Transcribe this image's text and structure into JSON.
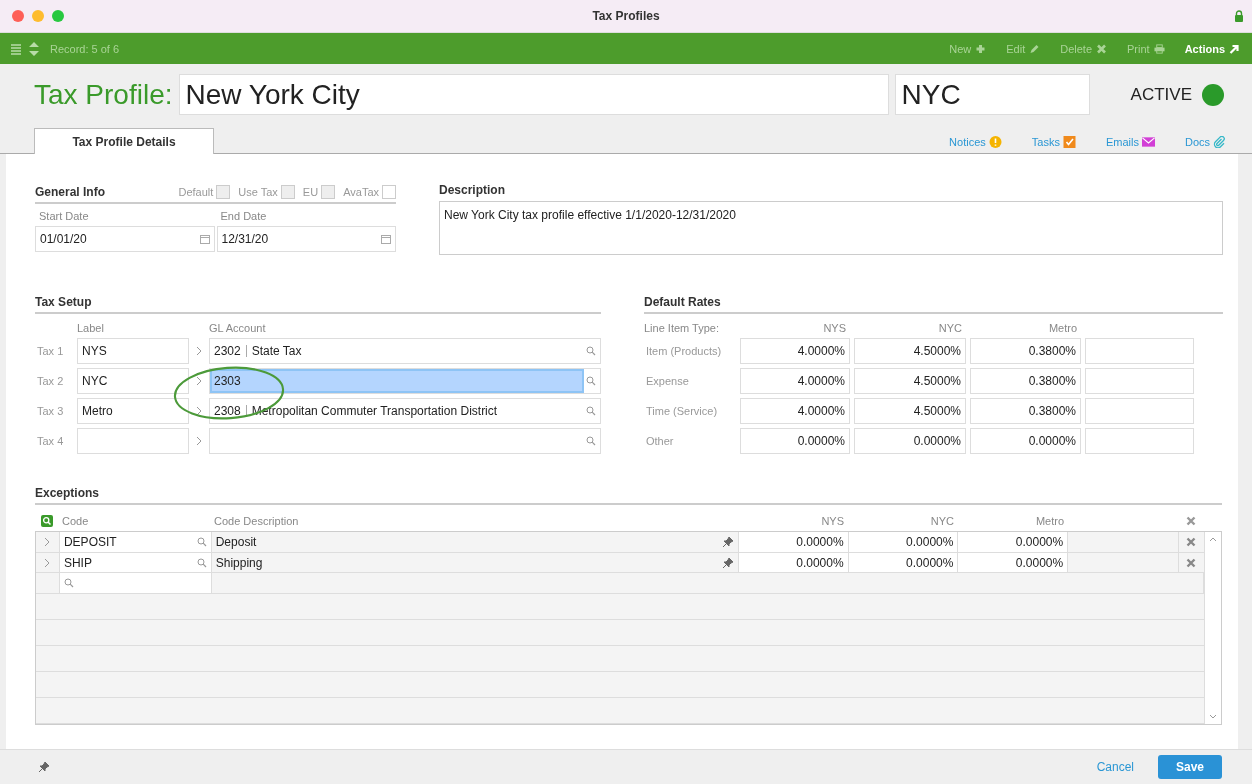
{
  "window": {
    "title": "Tax Profiles"
  },
  "toolbar": {
    "record": "Record: 5 of 6",
    "actions": [
      {
        "label": "New",
        "kind": "new",
        "disabled": true
      },
      {
        "label": "Edit",
        "kind": "edit",
        "disabled": true
      },
      {
        "label": "Delete",
        "kind": "delete",
        "disabled": true
      },
      {
        "label": "Print",
        "kind": "print",
        "disabled": true
      },
      {
        "label": "Actions",
        "kind": "actions",
        "disabled": false
      }
    ]
  },
  "header": {
    "label": "Tax Profile:",
    "name": "New York City",
    "code": "NYC",
    "status": "ACTIVE",
    "active": true
  },
  "tabs": [
    {
      "label": "Tax Profile Details",
      "selected": true
    }
  ],
  "links": [
    {
      "label": "Notices",
      "kind": "notices"
    },
    {
      "label": "Tasks",
      "kind": "tasks"
    },
    {
      "label": "Emails",
      "kind": "emails"
    },
    {
      "label": "Docs",
      "kind": "docs"
    }
  ],
  "general_info": {
    "title": "General Info",
    "flags": [
      {
        "label": "Default",
        "checked": false,
        "disabled": true
      },
      {
        "label": "Use Tax",
        "checked": false,
        "disabled": true
      },
      {
        "label": "EU",
        "checked": false,
        "disabled": true
      },
      {
        "label": "AvaTax",
        "checked": false,
        "disabled": false
      }
    ],
    "start_date": {
      "label": "Start Date",
      "value": "01/01/20"
    },
    "end_date": {
      "label": "End Date",
      "value": "12/31/20"
    }
  },
  "description": {
    "title": "Description",
    "value": "New York City tax profile effective 1/1/2020-12/31/2020"
  },
  "tax_setup": {
    "title": "Tax Setup",
    "label_header": "Label",
    "account_header": "GL Account",
    "rows": [
      {
        "name": "Tax 1",
        "label": "NYS",
        "account": "2302",
        "account_name": "State Tax",
        "selected": false
      },
      {
        "name": "Tax 2",
        "label": "NYC",
        "account": "2303",
        "selected": true
      },
      {
        "name": "Tax 3",
        "label": "Metro",
        "account": "2308",
        "account_name": "Metropolitan Commuter Transportation District",
        "selected": false
      },
      {
        "name": "Tax 4",
        "selected": false
      }
    ]
  },
  "default_rates": {
    "title": "Default Rates",
    "type_header": "Line Item Type:",
    "columns": [
      "NYS",
      "NYC",
      "Metro"
    ],
    "rows": [
      {
        "type": "Item (Products)",
        "rates": [
          "4.0000%",
          "4.5000%",
          "0.3800%"
        ]
      },
      {
        "type": "Expense",
        "rates": [
          "4.0000%",
          "4.5000%",
          "0.3800%"
        ]
      },
      {
        "type": "Time (Service)",
        "rates": [
          "4.0000%",
          "4.5000%",
          "0.3800%"
        ]
      },
      {
        "type": "Other",
        "rates": [
          "0.0000%",
          "0.0000%",
          "0.0000%"
        ]
      }
    ]
  },
  "exceptions": {
    "title": "Exceptions",
    "code_header": "Code",
    "description_header": "Code Description",
    "rate_headers": [
      "NYS",
      "NYC",
      "Metro"
    ],
    "rows": [
      {
        "code": "DEPOSIT",
        "description": "Deposit",
        "rates": [
          "0.0000%",
          "0.0000%",
          "0.0000%"
        ]
      },
      {
        "code": "SHIP",
        "description": "Shipping",
        "rates": [
          "0.0000%",
          "0.0000%",
          "0.0000%"
        ]
      }
    ]
  },
  "footer": {
    "cancel": "Cancel",
    "save": "Save"
  }
}
